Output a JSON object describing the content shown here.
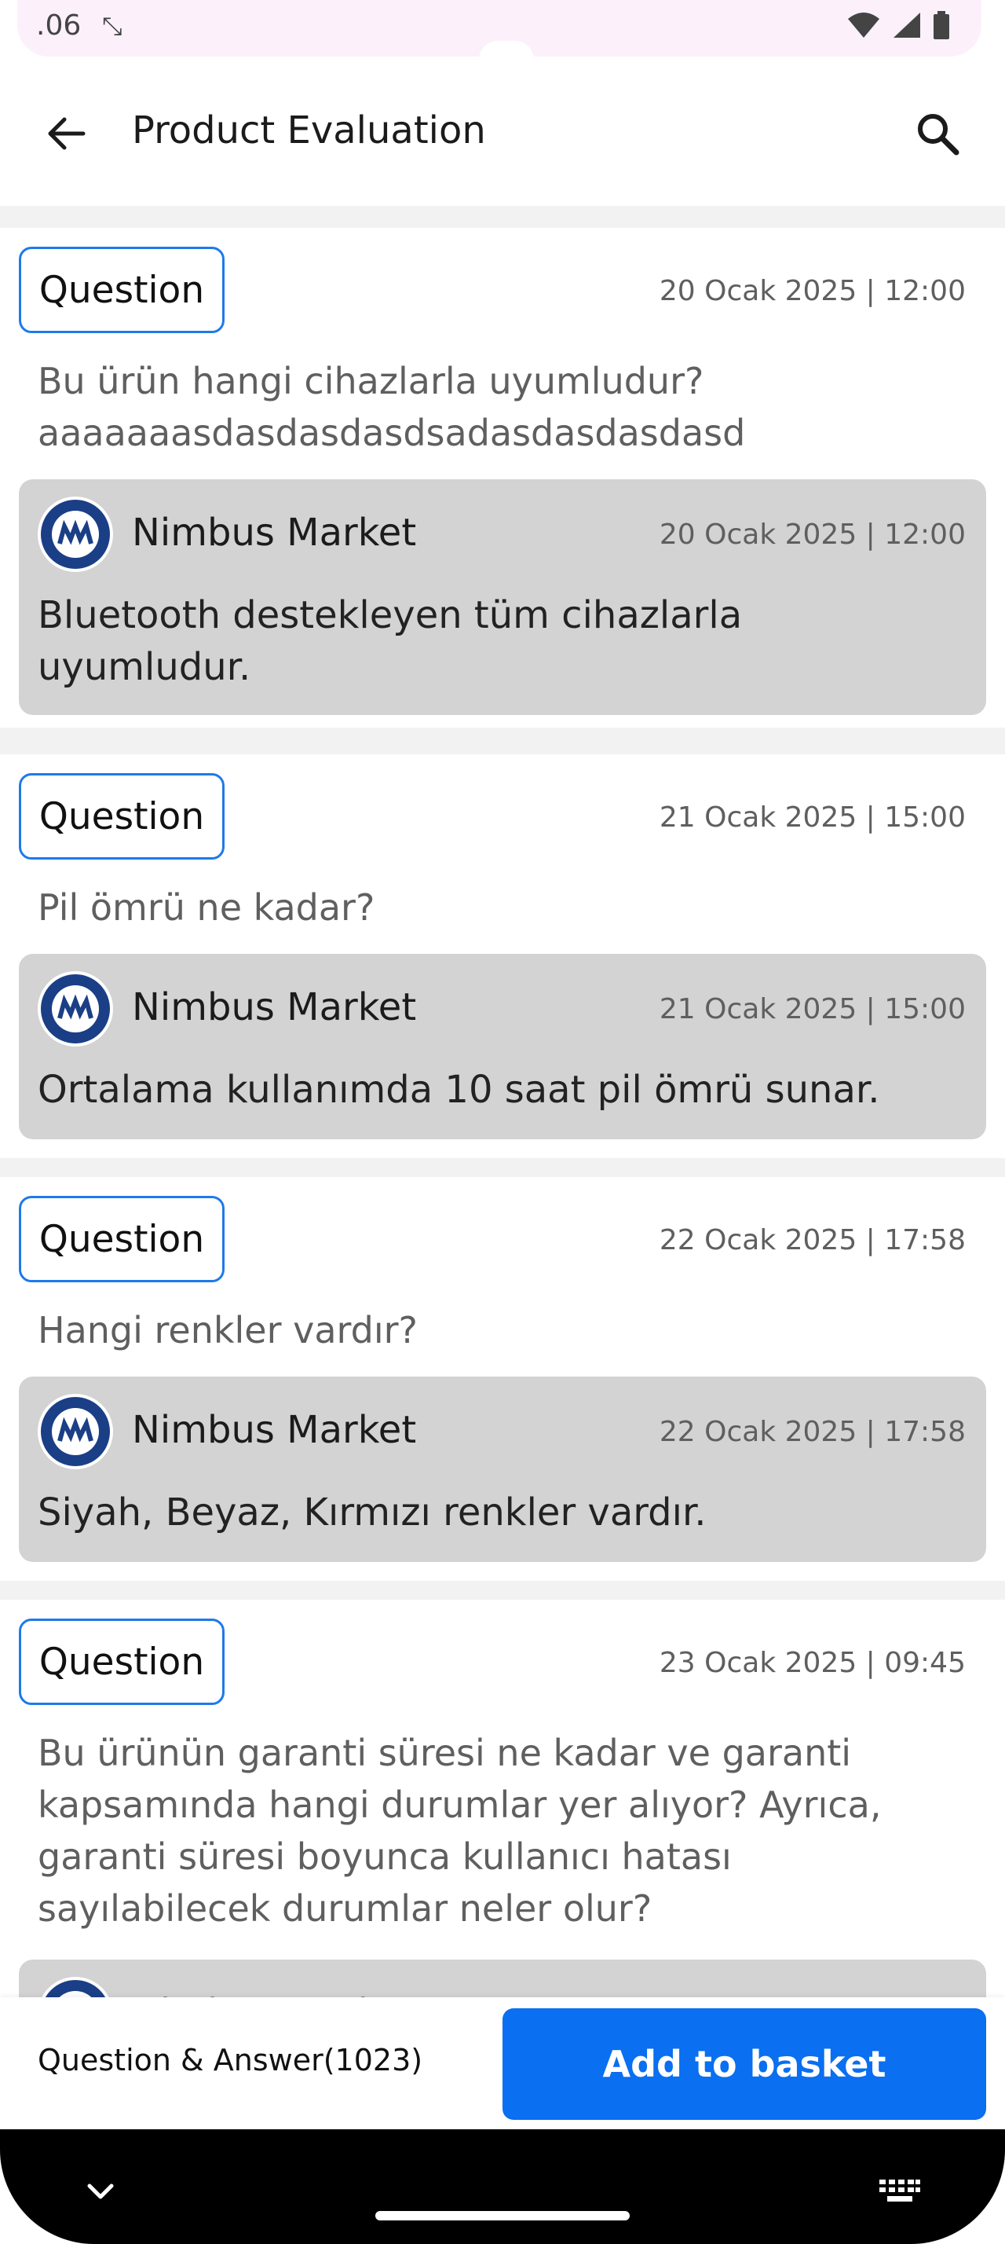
{
  "status_bar": {
    "time": ".06"
  },
  "app_bar": {
    "title": "Product Evaluation"
  },
  "questions": [
    {
      "chip": "Question",
      "date": "20 Ocak 2025 | 12:00",
      "text": "Bu ürün hangi cihazlarla uyumludur? aaaaaaasdasdasdasdsadasdasdasdasd",
      "answer": {
        "seller": "Nimbus Market",
        "date": "20 Ocak 2025 | 12:00",
        "text": "Bluetooth destekleyen tüm cihazlarla uyumludur."
      }
    },
    {
      "chip": "Question",
      "date": "21 Ocak 2025 | 15:00",
      "text": "Pil ömrü ne kadar?",
      "answer": {
        "seller": "Nimbus Market",
        "date": "21 Ocak 2025 | 15:00",
        "text": "Ortalama kullanımda 10 saat pil ömrü sunar."
      }
    },
    {
      "chip": "Question",
      "date": "22 Ocak 2025 | 17:58",
      "text": "Hangi renkler vardır?",
      "answer": {
        "seller": "Nimbus Market",
        "date": "22 Ocak 2025 | 17:58",
        "text": "Siyah, Beyaz, Kırmızı renkler vardır."
      }
    },
    {
      "chip": "Question",
      "date": "23 Ocak 2025 | 09:45",
      "text": "Bu ürünün garanti süresi ne kadar ve garanti kapsamında hangi durumlar yer alıyor? Ayrıca, garanti süresi boyunca kullanıcı hatası sayılabilecek durumlar neler olur?",
      "answer": {
        "seller": "Nimbus Market"
      }
    }
  ],
  "bottom_bar": {
    "qa_label": "Question & Answer(1023)",
    "basket_label": "Add to basket"
  },
  "colors": {
    "accent": "#0a6ff0",
    "chip_border": "#1e7ae8",
    "answer_bg": "#d3d3d3",
    "logo_navy": "#1b3f86"
  },
  "icons": [
    "back-arrow-icon",
    "search-icon",
    "wifi-icon",
    "signal-icon",
    "battery-icon",
    "screen-rotate-icon",
    "chevron-down-icon",
    "keyboard-icon"
  ]
}
